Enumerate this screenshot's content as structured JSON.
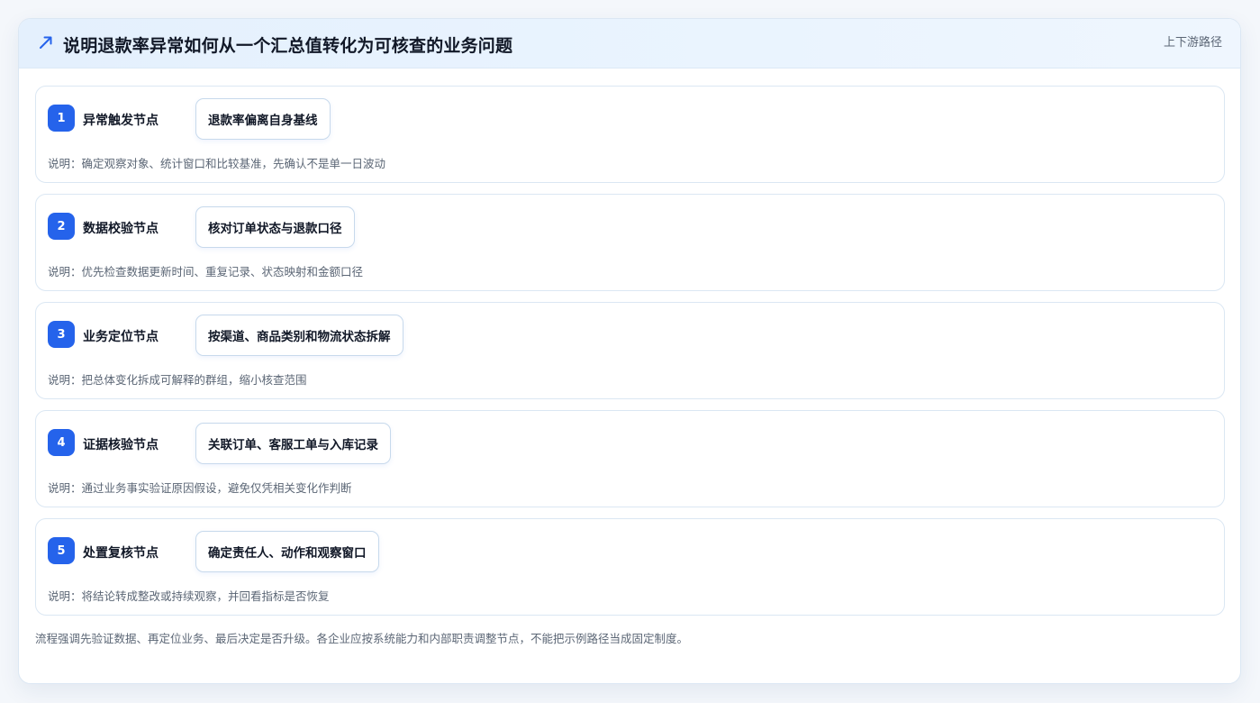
{
  "header": {
    "title": "说明退款率异常如何从一个汇总值转化为可核查的业务问题",
    "tag": "上下游路径",
    "icon": "trend-arrow-icon",
    "accent": "#2563eb"
  },
  "steps": [
    {
      "number": "1",
      "title": "异常触发节点",
      "pill": "退款率偏离自身基线",
      "desc": "说明：确定观察对象、统计窗口和比较基准，先确认不是单一日波动"
    },
    {
      "number": "2",
      "title": "数据校验节点",
      "pill": "核对订单状态与退款口径",
      "desc": "说明：优先检查数据更新时间、重复记录、状态映射和金额口径"
    },
    {
      "number": "3",
      "title": "业务定位节点",
      "pill": "按渠道、商品类别和物流状态拆解",
      "desc": "说明：把总体变化拆成可解释的群组，缩小核查范围"
    },
    {
      "number": "4",
      "title": "证据核验节点",
      "pill": "关联订单、客服工单与入库记录",
      "desc": "说明：通过业务事实验证原因假设，避免仅凭相关变化作判断"
    },
    {
      "number": "5",
      "title": "处置复核节点",
      "pill": "确定责任人、动作和观察窗口",
      "desc": "说明：将结论转成整改或持续观察，并回看指标是否恢复"
    }
  ],
  "footnote": "流程强调先验证数据、再定位业务、最后决定是否升级。各企业应按系统能力和内部职责调整节点，不能把示例路径当成固定制度。"
}
